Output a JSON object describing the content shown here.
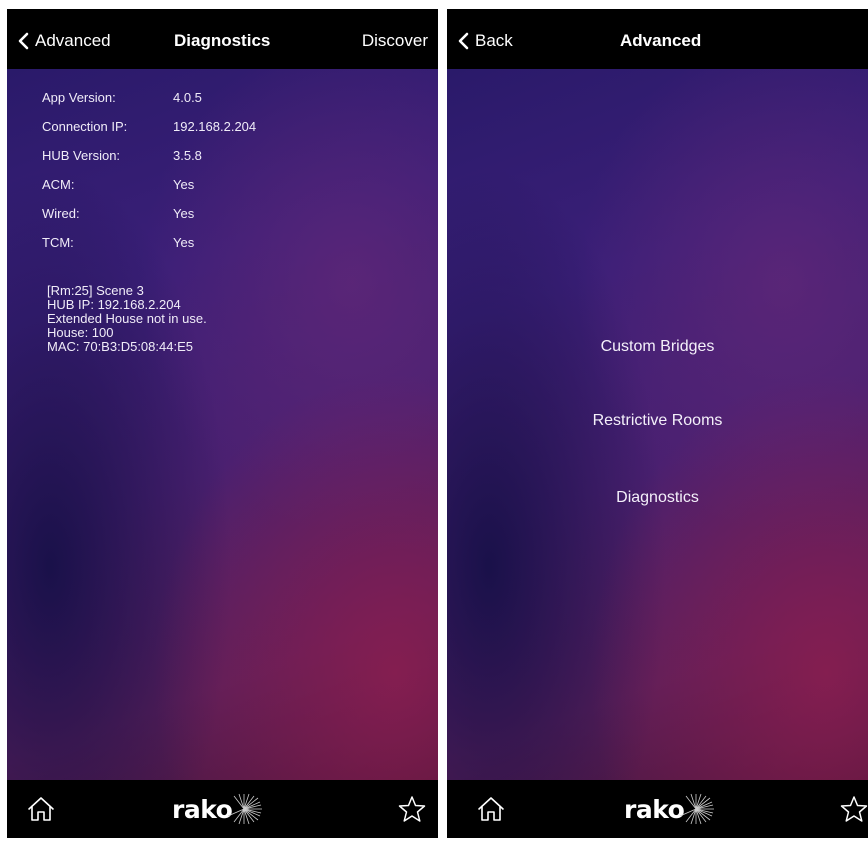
{
  "left_screen": {
    "nav": {
      "back_label": "Advanced",
      "title": "Diagnostics",
      "right_label": "Discover"
    },
    "info_rows": [
      {
        "label": "App Version:",
        "value": "4.0.5"
      },
      {
        "label": "Connection IP:",
        "value": "192.168.2.204"
      },
      {
        "label": "HUB Version:",
        "value": "3.5.8"
      },
      {
        "label": "ACM:",
        "value": "Yes"
      },
      {
        "label": "Wired:",
        "value": "Yes"
      },
      {
        "label": "TCM:",
        "value": "Yes"
      }
    ],
    "diagnostic_lines": [
      "[Rm:25] Scene 3",
      "HUB IP: 192.168.2.204",
      "Extended House not in use.",
      "House: 100",
      "MAC: 70:B3:D5:08:44:E5"
    ]
  },
  "right_screen": {
    "nav": {
      "back_label": "Back",
      "title": "Advanced"
    },
    "menu_items": [
      "Custom Bridges",
      "Restrictive Rooms",
      "Diagnostics"
    ]
  },
  "tabbar": {
    "logo_text": "rako",
    "icons": [
      "home-icon",
      "star-icon"
    ]
  },
  "colors": {
    "nav_background": "#000000",
    "text": "#ffffff",
    "gradient_dark": "#2a1a6a",
    "gradient_magenta": "#8c1e50"
  }
}
